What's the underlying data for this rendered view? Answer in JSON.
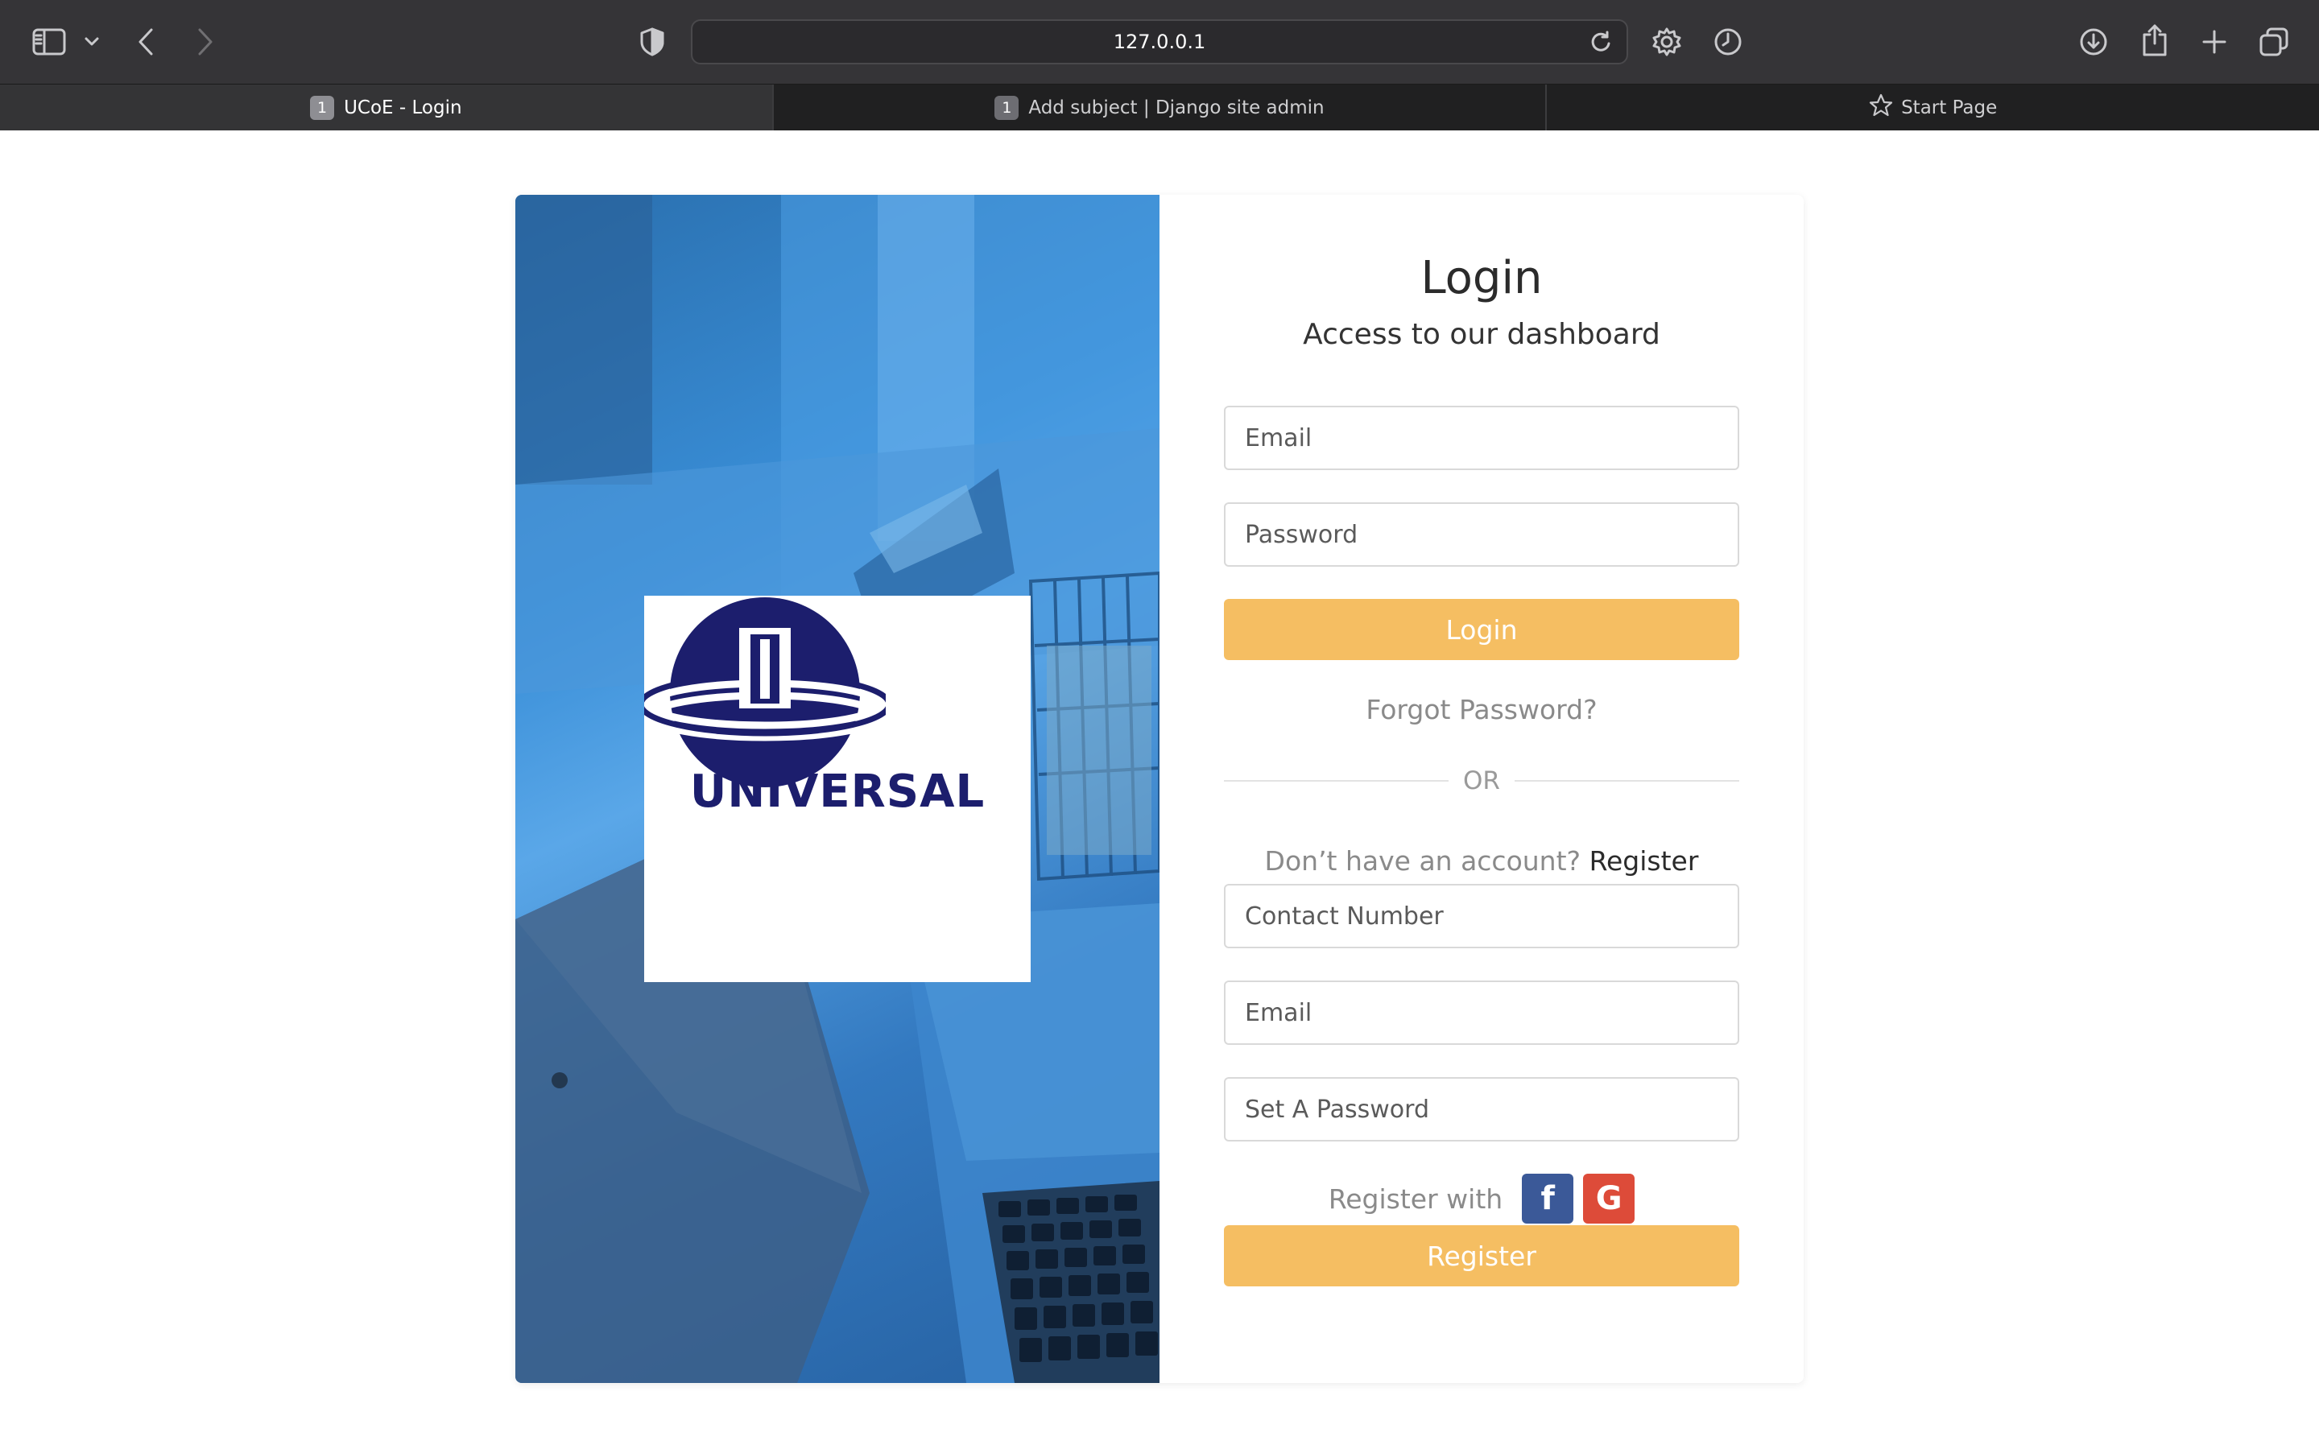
{
  "browser": {
    "url": "127.0.0.1",
    "tabs": [
      {
        "badge": "1",
        "title": "UCoE - Login",
        "active": true
      },
      {
        "badge": "1",
        "title": "Add subject | Django site admin",
        "active": false
      },
      {
        "title": "Start Page",
        "active": false
      }
    ]
  },
  "brand": {
    "logo_text": "UNIVERSAL",
    "logo_color": "#1c1e6d"
  },
  "login": {
    "title": "Login",
    "subtitle": "Access to our dashboard",
    "email_placeholder": "Email",
    "password_placeholder": "Password",
    "login_button": "Login",
    "forgot_link": "Forgot Password?",
    "or_label": "OR"
  },
  "register": {
    "prompt": "Don’t have an account?",
    "prompt_link": "Register",
    "contact_placeholder": "Contact Number",
    "email_placeholder": "Email",
    "password_placeholder": "Set A Password",
    "register_with": "Register with",
    "facebook_icon": "f",
    "google_icon": "G",
    "register_button": "Register"
  },
  "colors": {
    "accent": "#f5be62",
    "facebook": "#3b5998",
    "google": "#dd4b39",
    "hero": "#3a8fd8"
  }
}
